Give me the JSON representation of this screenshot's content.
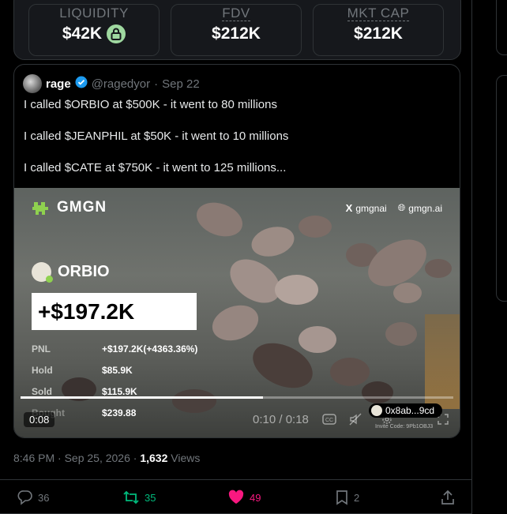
{
  "stats": {
    "liquidity_label": "LIQUIDITY",
    "liquidity_value": "$42K",
    "fdv_label": "FDV",
    "fdv_value": "$212K",
    "mktcap_label": "MKT CAP",
    "mktcap_value": "$212K",
    "lock_color": "#9fd8a0"
  },
  "quote": {
    "name": "rage",
    "handle": "@ragedyor",
    "separator": "·",
    "date": "Sep 22",
    "lines": [
      "I called $ORBIO at $500K - it went to 80 millions",
      "I called $JEANPHIL at $50K - it went to 10 millions",
      "I called $CATE at $750K - it went to 125 millions..."
    ],
    "verified_color": "#1d9bf0"
  },
  "media": {
    "brand": "GMGN",
    "x_link": "gmgnai",
    "web_link": "gmgn.ai",
    "token": "ORBIO",
    "pnl_big": "+$197.2K",
    "rows": [
      {
        "key": "PNL",
        "value": "+$197.2K(+4363.36%)"
      },
      {
        "key": "Hold",
        "value": "$85.9K"
      },
      {
        "key": "Sold",
        "value": "$115.9K"
      },
      {
        "key": "Bought",
        "value": "$239.88"
      }
    ],
    "elapsed_badge": "0:08",
    "time_readout": "0:10 / 0:18",
    "progress_fraction": 0.56,
    "address": "0x8ab...9cd",
    "invite_code": "Invite Code: 9Pb1OBJ3",
    "brand_color": "#8fd14f"
  },
  "meta": {
    "time": "8:46 PM · Sep 25, 2026 ·",
    "views_count": "1,632",
    "views_label": "Views"
  },
  "actions": {
    "replies": "36",
    "reposts": "35",
    "likes": "49",
    "bookmarks": "2",
    "repost_color": "#00ba7c",
    "like_color": "#f91880"
  }
}
